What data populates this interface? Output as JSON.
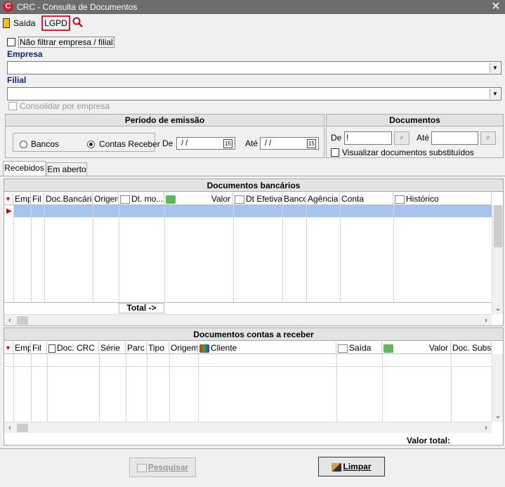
{
  "window": {
    "title": "CRC - Consulta de Documentos",
    "logo": "C"
  },
  "toolbar": {
    "exit_label": "Saída",
    "lgpd_label": "LGPD"
  },
  "filters": {
    "no_filter_label": "Não filtrar empresa / filial",
    "empresa_label": "Empresa",
    "filial_label": "Filial",
    "consolidar_label": "Consolidar por empresa"
  },
  "periodo": {
    "header": "Período de emissão",
    "radio_bancos": "Bancos",
    "radio_contas": "Contas Receber",
    "de_label": "De",
    "ate_label": "Até",
    "de_value": " /  /",
    "ate_value": " /  /",
    "cal_icon": "15"
  },
  "documentos": {
    "header": "Documentos",
    "de_label": "De",
    "de_value": "!",
    "ate_label": "Até",
    "ate_value": "",
    "visualizar_label": "Visualizar documentos substituídos"
  },
  "tabs": [
    "Recebidos",
    "Em aberto"
  ],
  "bancarios": {
    "caption": "Documentos bancários",
    "columns": [
      "Emp",
      "Fil",
      "Doc.Bancário",
      "Origem",
      "Dt. mo...",
      "Valor",
      "Dt Efetiva",
      "Banco",
      "Agência",
      "Conta",
      "Histórico"
    ],
    "total_label": "Total ->"
  },
  "contas": {
    "caption": "Documentos contas a receber",
    "columns": [
      "Emp",
      "Fil",
      "Doc. CRC",
      "Série",
      "Parc",
      "Tipo",
      "Origem",
      "Cliente",
      "Saída",
      "Valor",
      "Doc. Subst."
    ],
    "valor_total_label": "Valor total:"
  },
  "buttons": {
    "pesquisar": "Pesquisar",
    "limpar": "Limpar"
  },
  "colors": {
    "titlebar": "#6d6d6d",
    "label_blue": "#0b2a7a",
    "selected_row": "#a6c4ef",
    "lgpd_border": "#e02020"
  }
}
